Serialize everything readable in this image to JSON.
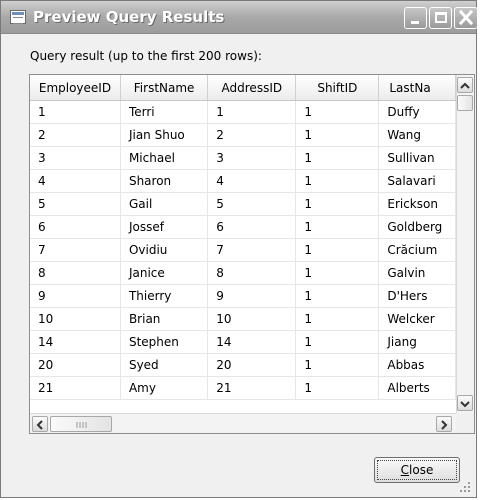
{
  "window": {
    "title": "Preview Query Results"
  },
  "caption": "Query result (up to the first 200 rows):",
  "table": {
    "columns": [
      "EmployeeID",
      "FirstName",
      "AddressID",
      "ShiftID",
      "LastNa"
    ],
    "rows": [
      [
        "1",
        "Terri",
        "1",
        "1",
        "Duffy"
      ],
      [
        "2",
        "Jian Shuo",
        "2",
        "1",
        "Wang"
      ],
      [
        "3",
        "Michael",
        "3",
        "1",
        "Sullivan"
      ],
      [
        "4",
        "Sharon",
        "4",
        "1",
        "Salavari"
      ],
      [
        "5",
        "Gail",
        "5",
        "1",
        "Erickson"
      ],
      [
        "6",
        "Jossef",
        "6",
        "1",
        "Goldberg"
      ],
      [
        "7",
        "Ovidiu",
        "7",
        "1",
        "Crăcium"
      ],
      [
        "8",
        "Janice",
        "8",
        "1",
        "Galvin"
      ],
      [
        "9",
        "Thierry",
        "9",
        "1",
        "D'Hers"
      ],
      [
        "10",
        "Brian",
        "10",
        "1",
        "Welcker"
      ],
      [
        "14",
        "Stephen",
        "14",
        "1",
        "Jiang"
      ],
      [
        "20",
        "Syed",
        "20",
        "1",
        "Abbas"
      ],
      [
        "21",
        "Amy",
        "21",
        "1",
        "Alberts"
      ]
    ]
  },
  "buttons": {
    "close_mnemonic": "C",
    "close_rest": "lose"
  },
  "icons": {
    "app": "query-results-icon",
    "minimize": "minimize-icon",
    "maximize": "maximize-icon",
    "close": "close-icon",
    "scroll_up": "arrow-up-icon",
    "scroll_down": "arrow-down-icon",
    "scroll_left": "arrow-left-icon",
    "scroll_right": "arrow-right-icon",
    "grip": "resize-grip-icon"
  },
  "colors": {
    "title_bar": "#a9a9a9",
    "window_bg": "#f0f0f0",
    "grid_bg": "#ffffff"
  }
}
